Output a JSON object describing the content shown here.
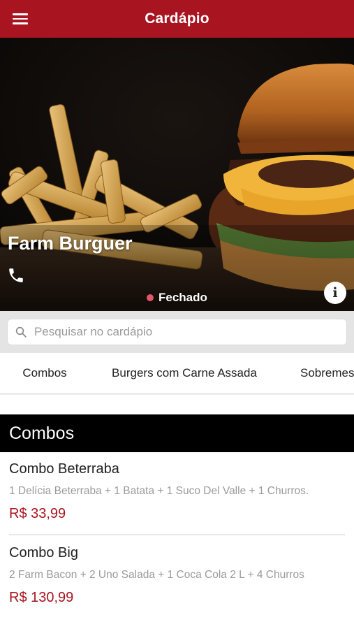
{
  "appbar": {
    "title": "Cardápio",
    "menu_icon": "hamburger-menu-icon"
  },
  "store": {
    "name": "Farm Burguer",
    "status": "Fechado",
    "status_color": "#e0566a",
    "phone_icon": "phone-icon",
    "info_icon": "info-icon",
    "info_glyph": "i"
  },
  "search": {
    "placeholder": "Pesquisar no cardápio",
    "value": ""
  },
  "tabs": [
    {
      "label": "Combos",
      "active": true
    },
    {
      "label": "Burgers com Carne Assada",
      "active": false
    },
    {
      "label": "Sobremesas",
      "active": false
    }
  ],
  "section": {
    "title": "Combos"
  },
  "items": [
    {
      "name": "Combo Beterraba",
      "description": "1 Delícia Beterraba + 1 Batata + 1 Suco Del Valle + 1 Churros.",
      "price": "R$ 33,99"
    },
    {
      "name": "Combo Big",
      "description": "2 Farm Bacon + 2 Uno Salada + 1 Coca Cola 2 L + 4 Churros",
      "price": "R$ 130,99"
    }
  ],
  "colors": {
    "brand": "#a8141f",
    "tab_indicator": "#4b1d73",
    "section_bg": "#000000"
  }
}
